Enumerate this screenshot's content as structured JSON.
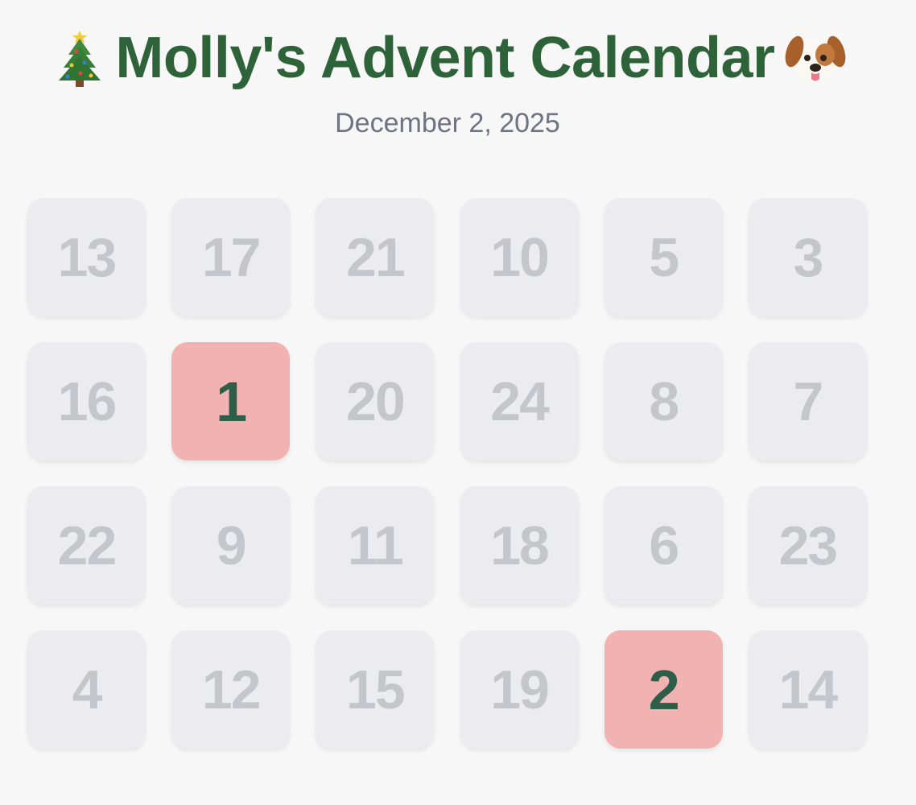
{
  "header": {
    "title": "Molly's Advent Calendar",
    "left_icon": "christmas-tree-icon",
    "right_icon": "dog-face-icon",
    "date": "December 2, 2025"
  },
  "colors": {
    "background": "#f7f7f7",
    "title": "#2e6339",
    "subtitle": "#6e7281",
    "door_closed_bg": "#ececf0",
    "door_closed_text": "#c5c6cc",
    "door_open_bg": "#f1b2b1",
    "door_open_text": "#2d5e48"
  },
  "doors": [
    {
      "label": "13",
      "opened": false
    },
    {
      "label": "17",
      "opened": false
    },
    {
      "label": "21",
      "opened": false
    },
    {
      "label": "10",
      "opened": false
    },
    {
      "label": "5",
      "opened": false
    },
    {
      "label": "3",
      "opened": false
    },
    {
      "label": "16",
      "opened": false
    },
    {
      "label": "1",
      "opened": true
    },
    {
      "label": "20",
      "opened": false
    },
    {
      "label": "24",
      "opened": false
    },
    {
      "label": "8",
      "opened": false
    },
    {
      "label": "7",
      "opened": false
    },
    {
      "label": "22",
      "opened": false
    },
    {
      "label": "9",
      "opened": false
    },
    {
      "label": "11",
      "opened": false
    },
    {
      "label": "18",
      "opened": false
    },
    {
      "label": "6",
      "opened": false
    },
    {
      "label": "23",
      "opened": false
    },
    {
      "label": "4",
      "opened": false
    },
    {
      "label": "12",
      "opened": false
    },
    {
      "label": "15",
      "opened": false
    },
    {
      "label": "19",
      "opened": false
    },
    {
      "label": "2",
      "opened": true
    },
    {
      "label": "14",
      "opened": false
    }
  ]
}
